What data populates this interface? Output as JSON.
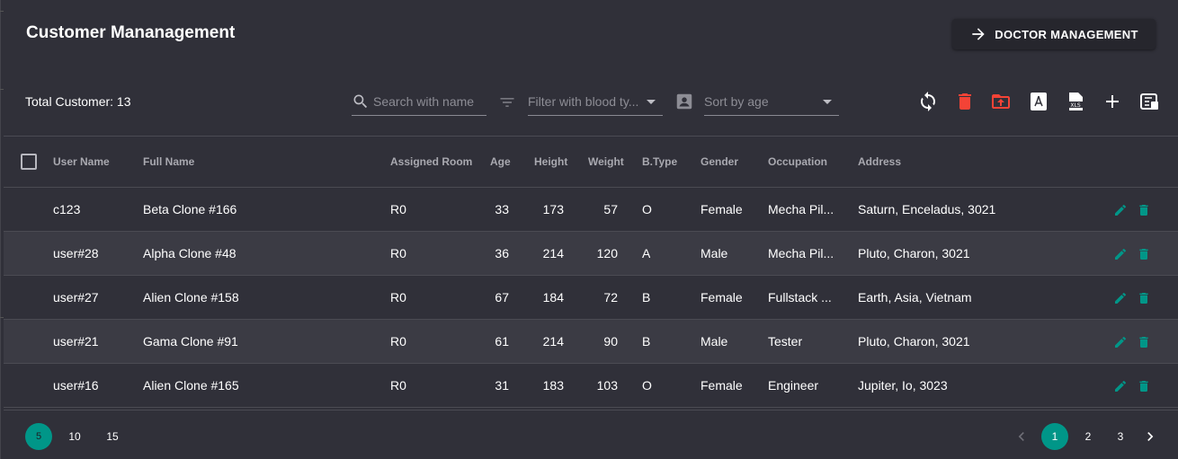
{
  "header": {
    "title": "Customer Mananagement",
    "doctor_button": "DOCTOR MANAGEMENT"
  },
  "summary": {
    "total_label": "Total Customer: 13"
  },
  "filters": {
    "search_placeholder": "Search with name",
    "blood_placeholder": "Filter with blood ty...",
    "sort_placeholder": "Sort by age"
  },
  "toolbar": {
    "icons": [
      "refresh-icon",
      "delete-icon",
      "upload-icon",
      "pdf-icon",
      "xls-icon",
      "add-icon",
      "view-column-icon"
    ],
    "danger_color": "#f44336"
  },
  "table": {
    "columns": {
      "user_name": "User Name",
      "full_name": "Full Name",
      "assigned_room": "Assigned Room",
      "age": "Age",
      "height": "Height",
      "weight": "Weight",
      "btype": "B.Type",
      "gender": "Gender",
      "occupation": "Occupation",
      "address": "Address"
    },
    "rows": [
      {
        "user_name": "c123",
        "full_name": "Beta Clone #166",
        "room": "R0",
        "age": "33",
        "height": "173",
        "weight": "57",
        "btype": "O",
        "gender": "Female",
        "occupation": "Mecha Pil...",
        "address": "Saturn, Enceladus, 3021"
      },
      {
        "user_name": "user#28",
        "full_name": "Alpha Clone #48",
        "room": "R0",
        "age": "36",
        "height": "214",
        "weight": "120",
        "btype": "A",
        "gender": "Male",
        "occupation": "Mecha Pil...",
        "address": "Pluto, Charon, 3021"
      },
      {
        "user_name": "user#27",
        "full_name": "Alien Clone #158",
        "room": "R0",
        "age": "67",
        "height": "184",
        "weight": "72",
        "btype": "B",
        "gender": "Female",
        "occupation": "Fullstack ...",
        "address": "Earth, Asia, Vietnam"
      },
      {
        "user_name": "user#21",
        "full_name": "Gama Clone #91",
        "room": "R0",
        "age": "61",
        "height": "214",
        "weight": "90",
        "btype": "B",
        "gender": "Male",
        "occupation": "Tester",
        "address": "Pluto, Charon, 3021"
      },
      {
        "user_name": "user#16",
        "full_name": "Alien Clone #165",
        "room": "R0",
        "age": "31",
        "height": "183",
        "weight": "103",
        "btype": "O",
        "gender": "Female",
        "occupation": "Engineer",
        "address": "Jupiter, Io, 3023"
      }
    ],
    "action_color": "#009688"
  },
  "pagination": {
    "page_sizes": [
      "5",
      "10",
      "15"
    ],
    "pages": [
      "1",
      "2",
      "3"
    ],
    "accent": "#009688"
  }
}
